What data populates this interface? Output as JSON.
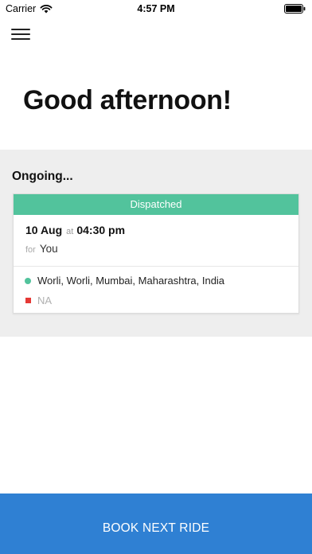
{
  "status_bar": {
    "carrier": "Carrier",
    "time": "4:57 PM",
    "wifi_icon": "wifi-icon",
    "battery_icon": "battery-icon"
  },
  "header": {
    "menu_icon": "hamburger-menu-icon"
  },
  "greeting": "Good afternoon!",
  "ongoing": {
    "title": "Ongoing...",
    "ride": {
      "status": "Dispatched",
      "date": "10 Aug",
      "at_label": "at",
      "time": "04:30 pm",
      "for_label": "for",
      "passenger": "You",
      "pickup": "Worli, Worli, Mumbai, Maharashtra, India",
      "drop": "NA"
    }
  },
  "book_button": {
    "label": "BOOK NEXT RIDE"
  },
  "colors": {
    "accent_green": "#52c39c",
    "drop_red": "#e53935",
    "button_blue": "#2f80d3",
    "section_gray": "#eeeeee"
  }
}
